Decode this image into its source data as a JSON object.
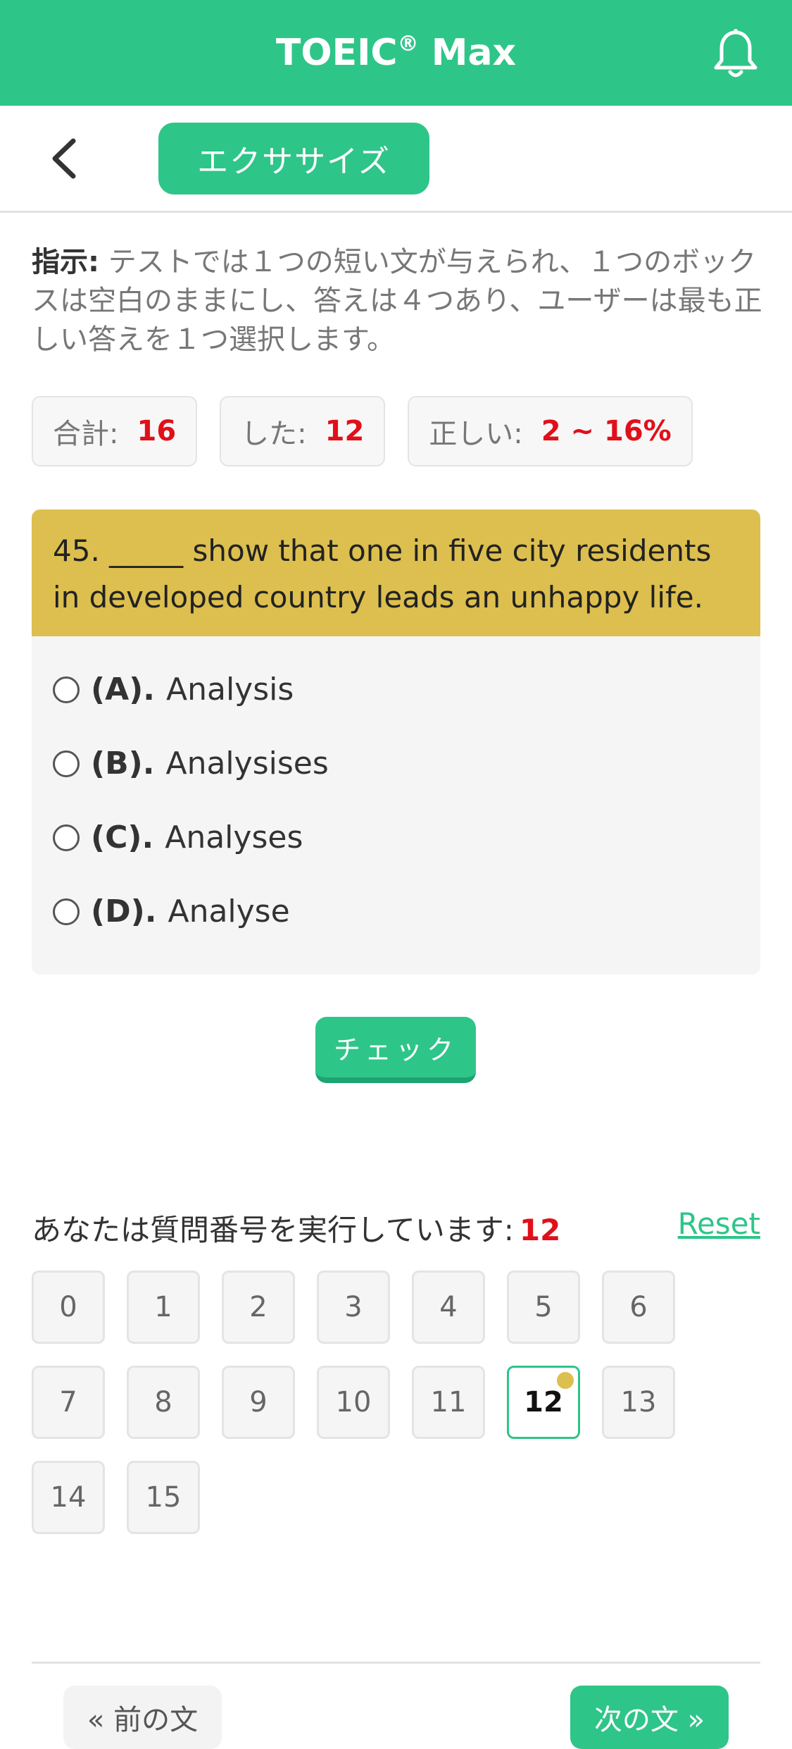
{
  "appbar": {
    "title": "TOEIC",
    "reg": "®",
    "title_suffix": "Max"
  },
  "toolbar": {
    "exercise_label": "エクササイズ"
  },
  "instructions": {
    "label": "指示:",
    "text": "テストでは１つの短い文が与えられ、１つのボックスは空白のままにし、答えは４つあり、ユーザーは最も正しい答えを１つ選択します。"
  },
  "stats": {
    "total_label": "合計:",
    "total_value": "16",
    "done_label": "した:",
    "done_value": "12",
    "correct_label": "正しい:",
    "correct_value": "2 ~ 16%"
  },
  "question": {
    "text": "45. _____ show that one in five city residents in developed country leads an unhappy life.",
    "options": [
      {
        "key": "(A).",
        "text": "Analysis"
      },
      {
        "key": "(B).",
        "text": "Analysises"
      },
      {
        "key": "(C).",
        "text": "Analyses"
      },
      {
        "key": "(D).",
        "text": "Analyse"
      }
    ]
  },
  "check_label": "チェック",
  "progress": {
    "label": "あなたは質問番号を実行しています:",
    "current": "12",
    "reset_label": "Reset",
    "numbers": [
      "0",
      "1",
      "2",
      "3",
      "4",
      "5",
      "6",
      "7",
      "8",
      "9",
      "10",
      "11",
      "12",
      "13",
      "14",
      "15"
    ]
  },
  "nav": {
    "prev_label": "« 前の文",
    "next_label": "次の文 »"
  },
  "colors": {
    "accent": "#2ec589",
    "question_header": "#dcbf4e",
    "highlight": "#e0101a"
  },
  "icons": {
    "bell": "bell-icon",
    "back": "chevron-left-icon"
  }
}
